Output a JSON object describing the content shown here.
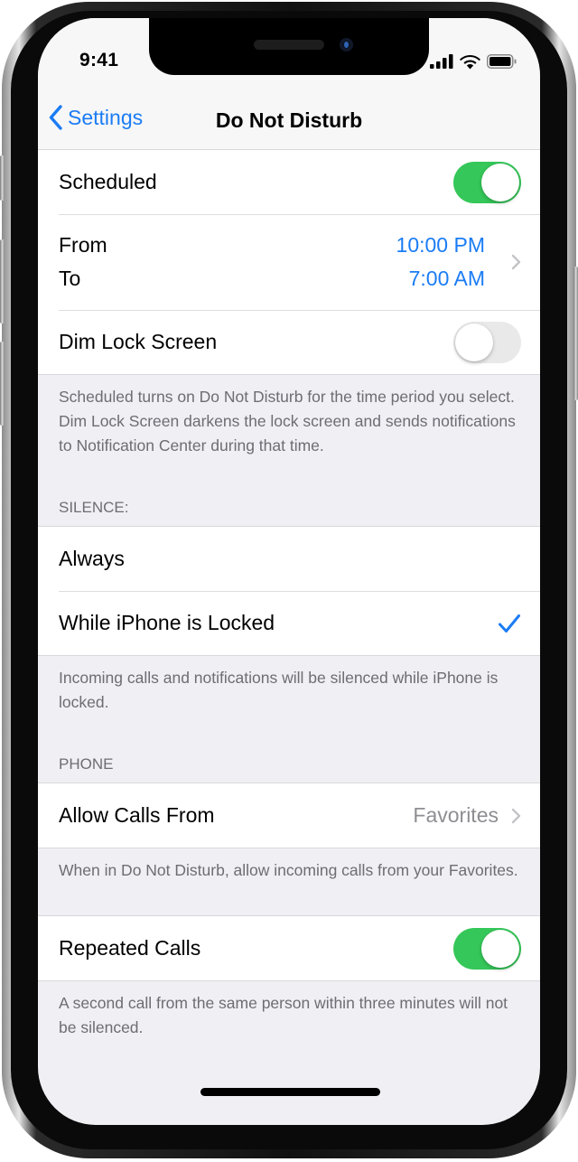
{
  "status_bar": {
    "time": "9:41",
    "icons": [
      "cellular-signal-icon",
      "wifi-icon",
      "battery-icon"
    ]
  },
  "nav": {
    "back_label": "Settings",
    "title": "Do Not Disturb"
  },
  "schedule": {
    "scheduled": {
      "label": "Scheduled",
      "enabled": true
    },
    "from_label": "From",
    "to_label": "To",
    "from_value": "10:00 PM",
    "to_value": "7:00 AM",
    "dim_lock": {
      "label": "Dim Lock Screen",
      "enabled": false
    },
    "footer": "Scheduled turns on Do Not Disturb for the time period you select. Dim Lock Screen darkens the lock screen and sends notifications to Notification Center during that time."
  },
  "silence": {
    "header": "SILENCE:",
    "options": [
      {
        "label": "Always",
        "selected": false
      },
      {
        "label": "While iPhone is Locked",
        "selected": true
      }
    ],
    "footer": "Incoming calls and notifications will be silenced while iPhone is locked."
  },
  "phone": {
    "header": "PHONE",
    "allow_calls": {
      "label": "Allow Calls From",
      "value": "Favorites"
    },
    "allow_footer": "When in Do Not Disturb, allow incoming calls from your Favorites.",
    "repeated_calls": {
      "label": "Repeated Calls",
      "enabled": true
    },
    "repeated_footer": "A second call from the same person within three minutes will not be silenced."
  },
  "colors": {
    "accent": "#1b7cf5",
    "switch_on": "#35c759",
    "switch_off": "#e9e9ea",
    "background": "#efeff4",
    "footer_text": "#6d6d72"
  }
}
